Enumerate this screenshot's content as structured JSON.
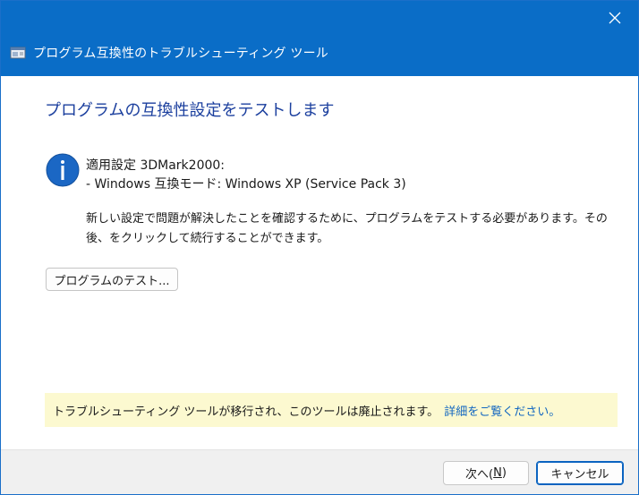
{
  "window": {
    "title": "プログラム互換性のトラブルシューティング ツール",
    "accent_color": "#0a6dc7",
    "icons": {
      "app": "troubleshooter-window-icon",
      "close": "close-icon",
      "info": "info-icon"
    }
  },
  "main": {
    "heading": "プログラムの互換性設定をテストします",
    "info_line1": "適用設定 3DMark2000:",
    "info_line2": "- Windows 互換モード: Windows XP (Service Pack 3)",
    "description": "新しい設定で問題が解決したことを確認するために、プログラムをテストする必要があります。その後、をクリックして続行することができます。",
    "test_button": "プログラムのテスト..."
  },
  "notice": {
    "text": "トラブルシューティング ツールが移行され、このツールは廃止されます。",
    "link": "詳細をご覧ください。",
    "link_color": "#1367c0"
  },
  "footer": {
    "next_label_prefix": "次へ(",
    "next_label_accel": "N",
    "next_label_suffix": ")",
    "cancel_label": "キャンセル"
  }
}
